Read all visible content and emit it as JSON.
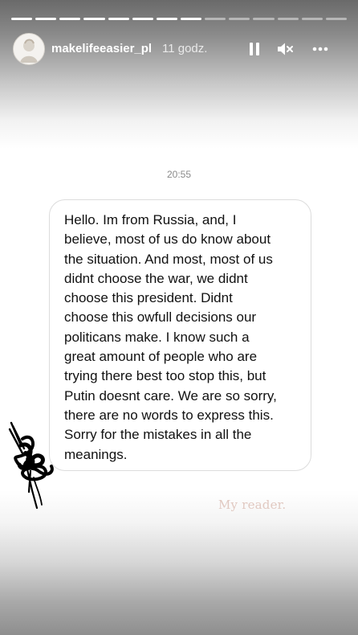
{
  "story": {
    "progress": {
      "total": 14,
      "current": 8
    },
    "header": {
      "username": "makelifeeasier_pl",
      "time_ago": "11 godz."
    },
    "controls": {
      "pause_icon": "pause-icon",
      "mute_icon": "speaker-muted-icon",
      "more_icon": "more-options-icon"
    },
    "message": {
      "timestamp": "20:55",
      "lines": [
        "Hello. Im from Russia, and, I",
        "believe, most of us do know about",
        "the situation. And most, most of us",
        "didnt choose the war, we didnt",
        "choose this president. Didnt",
        "choose this owfull decisions our",
        "politicans make. I know such a",
        "great amount of people who are",
        "trying there best too stop this, but",
        "Putin doesnt care. We are so sorry,",
        "there are no words to express this.",
        "Sorry for the mistakes in all the",
        "meanings."
      ]
    },
    "signature": "My reader.",
    "colors": {
      "text": "#111111",
      "bubble_border": "#dcdcdc",
      "signature": "#e1c9c1"
    }
  }
}
